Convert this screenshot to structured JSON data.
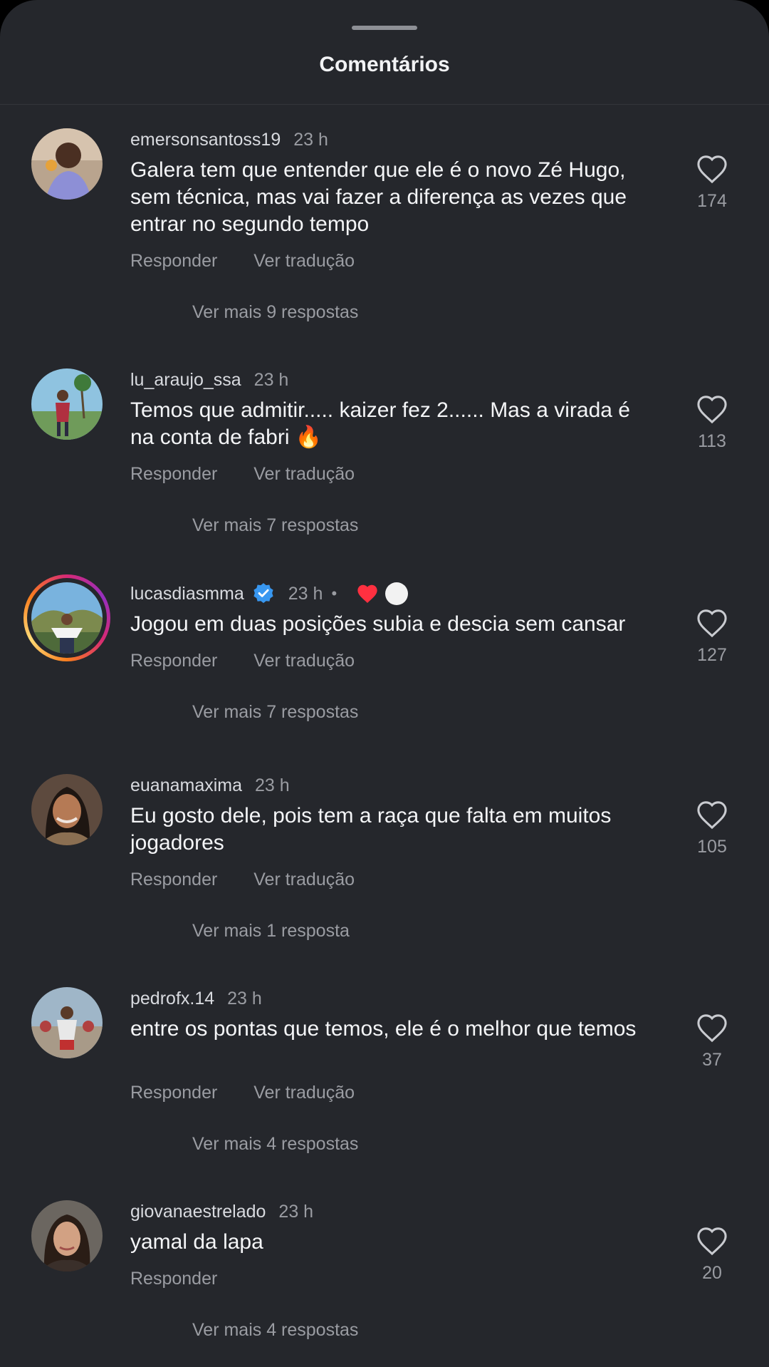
{
  "sheet": {
    "title": "Comentários"
  },
  "comments": [
    {
      "username": "emersonsantoss19",
      "time": "23 h",
      "text": "Galera tem que entender que ele é o novo Zé Hugo, sem técnica, mas vai fazer a diferença as vezes que entrar no segundo tempo",
      "reply": "Responder",
      "translate": "Ver tradução",
      "more": "Ver mais 9 respostas",
      "likes": "174"
    },
    {
      "username": "lu_araujo_ssa",
      "time": "23 h",
      "text": "Temos que admitir..... kaizer fez 2...... Mas a virada é na conta de fabri 🔥",
      "reply": "Responder",
      "translate": "Ver tradução",
      "more": "Ver mais 7 respostas",
      "likes": "113"
    },
    {
      "username": "lucasdiasmma",
      "time": "23 h",
      "text": "Jogou em duas posições subia e descia sem cansar",
      "reply": "Responder",
      "translate": "Ver tradução",
      "more": "Ver mais 7 respostas",
      "likes": "127",
      "verified": true,
      "has_story": true
    },
    {
      "username": "euanamaxima",
      "time": "23 h",
      "text": "Eu gosto dele, pois tem a raça que falta em muitos jogadores",
      "reply": "Responder",
      "translate": "Ver tradução",
      "more": "Ver mais 1 resposta",
      "likes": "105"
    },
    {
      "username": "pedrofx.14",
      "time": "23 h",
      "text": "entre os pontas que temos, ele é o melhor que temos",
      "reply": "Responder",
      "translate": "Ver tradução",
      "more": "Ver mais 4 respostas",
      "likes": "37"
    },
    {
      "username": "giovanaestrelado",
      "time": "23 h",
      "text": "yamal da lapa",
      "reply": "Responder",
      "more": "Ver mais 4 respostas",
      "likes": "20"
    }
  ],
  "icons": {
    "like": "heart-outline-icon",
    "verified": "verified-badge-icon",
    "reaction": "red-heart-icon",
    "accent_verified": "#3897f0",
    "accent_heart": "#ff3040"
  }
}
